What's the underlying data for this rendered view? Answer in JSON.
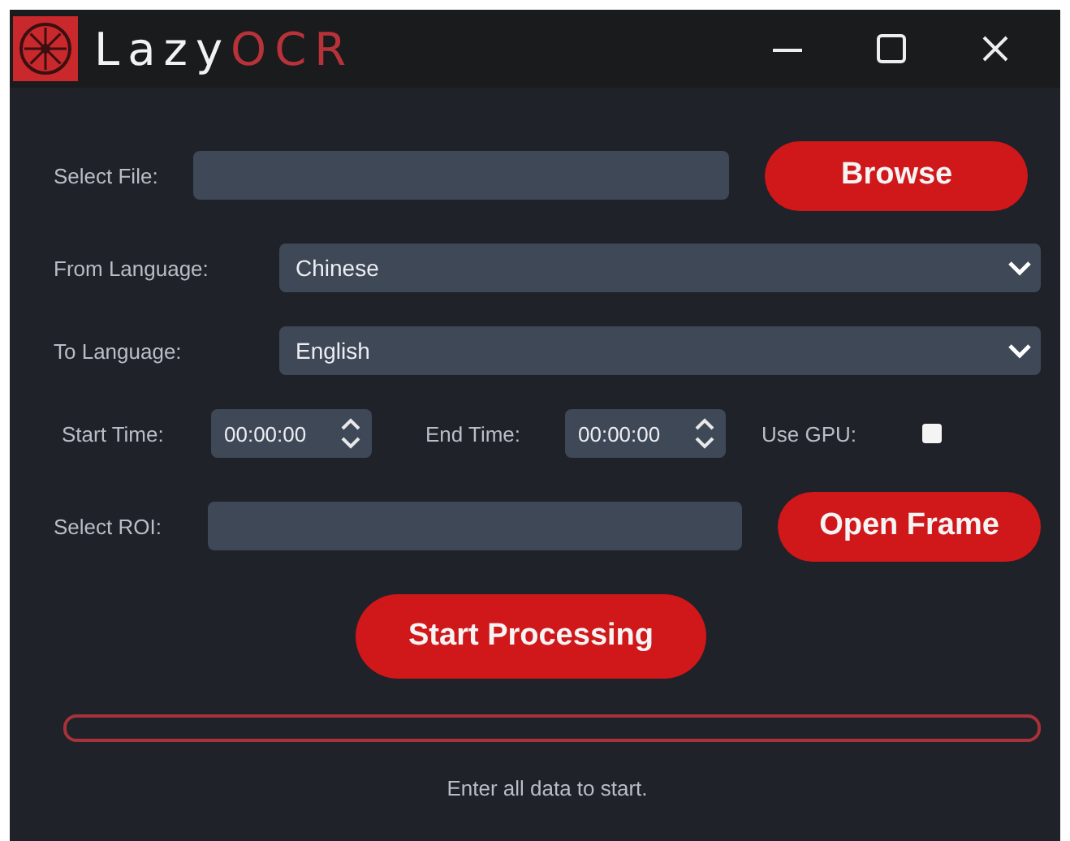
{
  "window": {
    "logo_text": [
      {
        "text": "Lazy",
        "color": "#f2f2f2"
      },
      {
        "text": "OCR",
        "color": "#b8323a"
      }
    ]
  },
  "file": {
    "label": "Select File:",
    "button": "Browse"
  },
  "from_language": {
    "label": "From Language:",
    "value": "Chinese"
  },
  "to_language": {
    "label": "To Language:",
    "value": "English"
  },
  "start_time": {
    "label": "Start Time:",
    "value": "00:00:00"
  },
  "end_time": {
    "label": "End Time:",
    "value": "00:00:00"
  },
  "use_gpu": {
    "label": "Use GPU:",
    "checked": false
  },
  "roi": {
    "label": "Select ROI:",
    "button": "Open Frame"
  },
  "start_button": "Start Processing",
  "progress": {
    "level": 0
  },
  "status": "Enter all data to start."
}
